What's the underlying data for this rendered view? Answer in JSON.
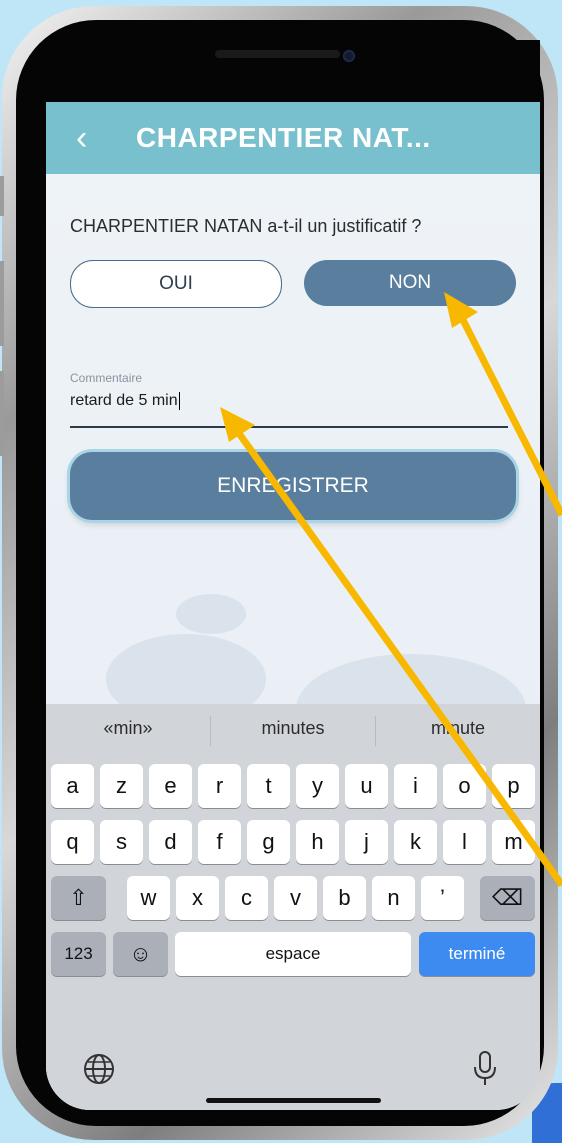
{
  "header": {
    "back_icon": "‹",
    "title": "CHARPENTIER NAT..."
  },
  "form": {
    "question": "CHARPENTIER NATAN a-t-il un justificatif ?",
    "option_yes": "OUI",
    "option_no": "NON",
    "selected": "NON",
    "comment_label": "Commentaire",
    "comment_value": "retard de 5 min",
    "save_label": "ENREGISTRER"
  },
  "keyboard": {
    "suggestions": [
      "«min»",
      "minutes",
      "minute"
    ],
    "row1": [
      "a",
      "z",
      "e",
      "r",
      "t",
      "y",
      "u",
      "i",
      "o",
      "p"
    ],
    "row2": [
      "q",
      "s",
      "d",
      "f",
      "g",
      "h",
      "j",
      "k",
      "l",
      "m"
    ],
    "row3": [
      "w",
      "x",
      "c",
      "v",
      "b",
      "n",
      "’"
    ],
    "shift_icon": "⇧",
    "backspace_icon": "⌫",
    "numbers_label": "123",
    "emoji_icon": "☺",
    "space_label": "espace",
    "done_label": "terminé",
    "globe_icon": "globe-icon",
    "mic_icon": "mic-icon"
  },
  "colors": {
    "header": "#79c0cf",
    "primary_button": "#5a7e9e",
    "done_key": "#3d8bf0",
    "arrow": "#f8b800"
  }
}
